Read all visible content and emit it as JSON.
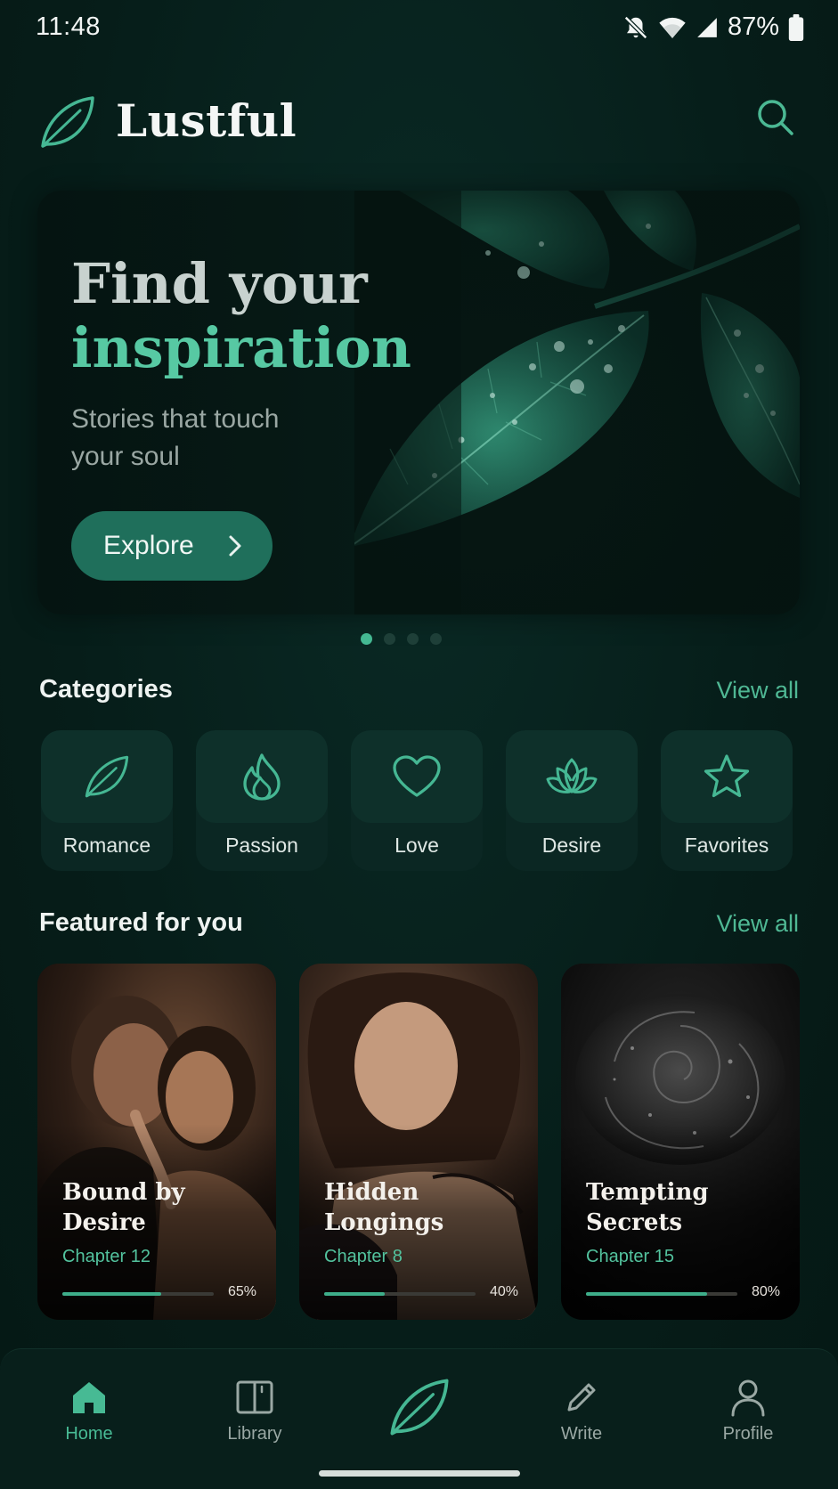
{
  "status_bar": {
    "time": "11:48",
    "battery": "87%",
    "icons": [
      "bell-off-icon",
      "wifi-icon",
      "cell-signal-icon",
      "battery-icon"
    ]
  },
  "header": {
    "title": "Lustful",
    "logo_icon": "leaf-icon",
    "search_icon": "search-icon"
  },
  "hero": {
    "title_line1": "Find your",
    "title_line2": "inspiration",
    "subtitle": "Stories that touch your soul",
    "button_label": "Explore",
    "slides_total": 4,
    "active_slide": 1
  },
  "categories": {
    "title": "Categories",
    "view_all": "View all",
    "items": [
      {
        "label": "Romance",
        "icon": "leaf-icon"
      },
      {
        "label": "Passion",
        "icon": "flame-icon"
      },
      {
        "label": "Love",
        "icon": "heart-icon"
      },
      {
        "label": "Desire",
        "icon": "lotus-icon"
      },
      {
        "label": "Favorites",
        "icon": "star-icon"
      }
    ]
  },
  "featured": {
    "title": "Featured for you",
    "view_all": "View all",
    "cards": [
      {
        "title": "Bound by Desire",
        "chapter": "Chapter 12",
        "progress": 65,
        "progress_label": "65%"
      },
      {
        "title": "Hidden Longings",
        "chapter": "Chapter 8",
        "progress": 40,
        "progress_label": "40%"
      },
      {
        "title": "Tempting Secrets",
        "chapter": "Chapter 15",
        "progress": 80,
        "progress_label": "80%"
      }
    ]
  },
  "nav": {
    "items": [
      {
        "label": "Home",
        "icon": "home-icon",
        "active": true
      },
      {
        "label": "Library",
        "icon": "book-icon",
        "active": false
      },
      {
        "label": "",
        "icon": "leaf-icon",
        "active": false
      },
      {
        "label": "Write",
        "icon": "pencil-icon",
        "active": false
      },
      {
        "label": "Profile",
        "icon": "user-icon",
        "active": false
      }
    ]
  },
  "colors": {
    "background": "#061d19",
    "accent": "#4fb894",
    "accent_bright": "#57c9a3",
    "button": "#1f6f5b"
  }
}
